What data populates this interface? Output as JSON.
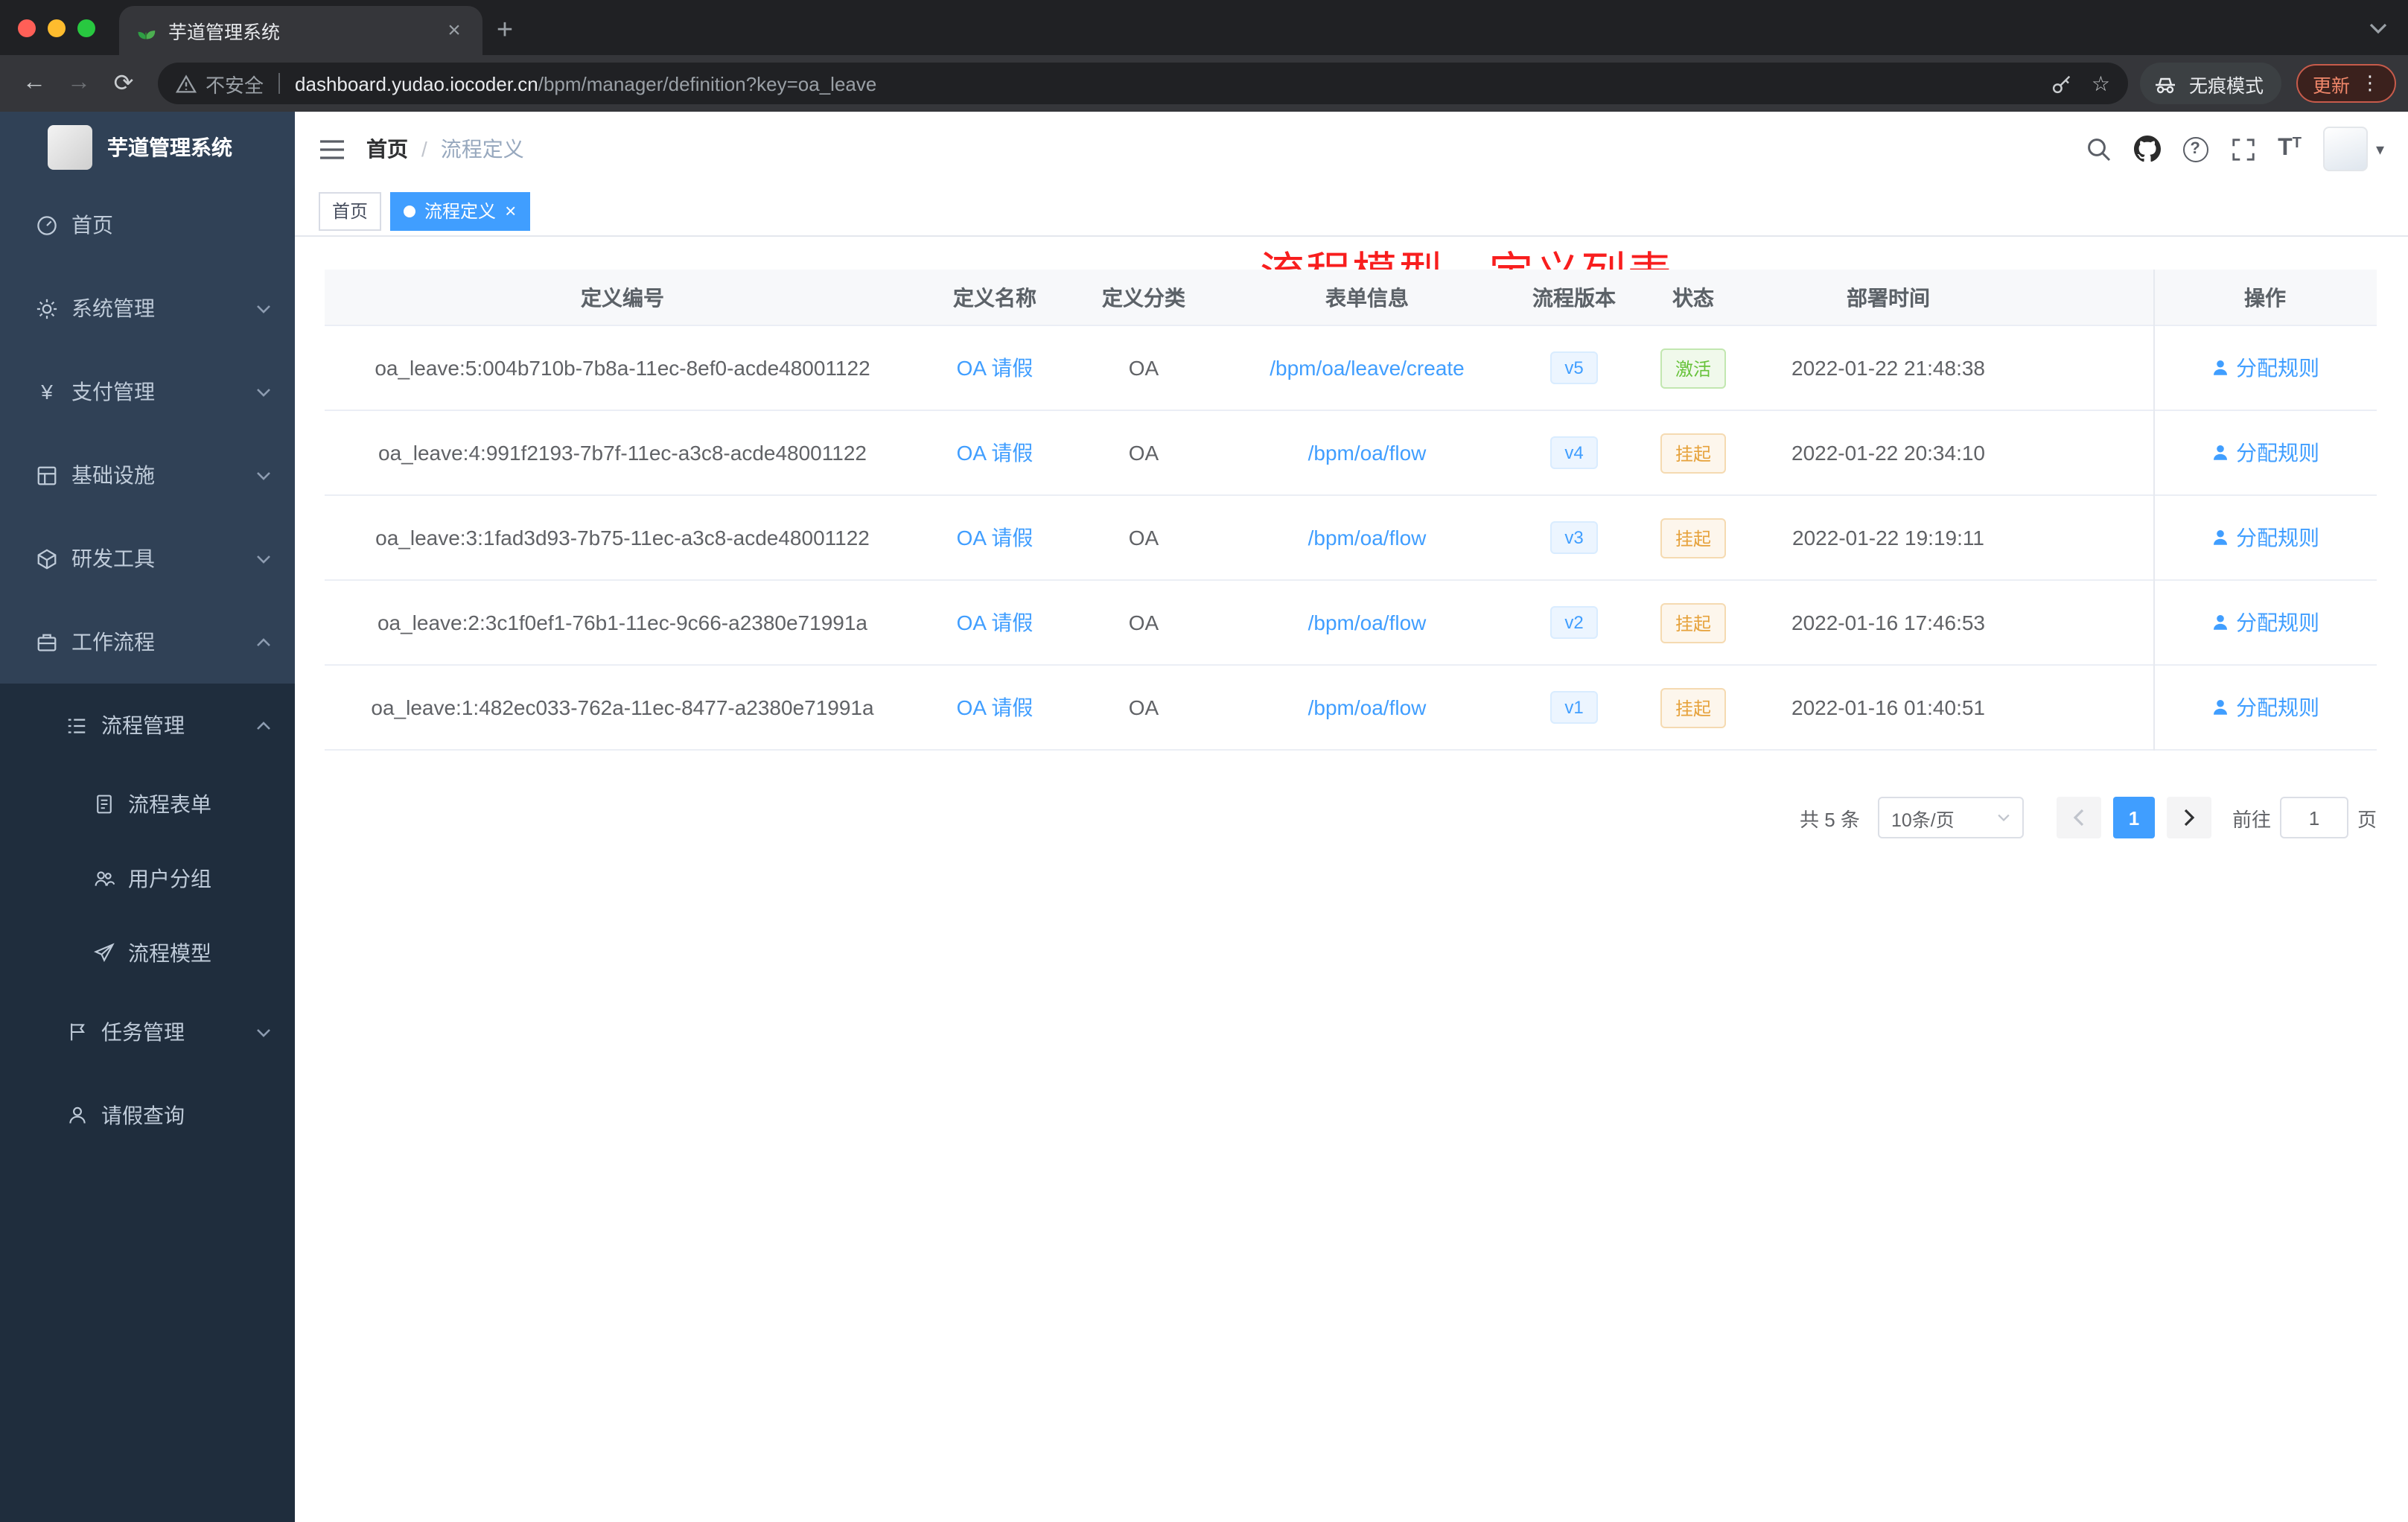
{
  "browser": {
    "tab_title": "芋道管理系统",
    "security_label": "不安全",
    "url_host": "dashboard.yudao.iocoder.cn",
    "url_path": "/bpm/manager/definition?key=oa_leave",
    "incognito_label": "无痕模式",
    "update_label": "更新"
  },
  "icons": {
    "close": "×",
    "new_tab": "+",
    "back": "←",
    "forward": "→",
    "reload": "⟳",
    "star": "☆",
    "overflow_dots": "⋮",
    "question": "?",
    "font_size": "T",
    "caret_down": "▾"
  },
  "sidebar": {
    "app_title": "芋道管理系统",
    "items": [
      {
        "label": "首页"
      },
      {
        "label": "系统管理"
      },
      {
        "label": "支付管理"
      },
      {
        "label": "基础设施"
      },
      {
        "label": "研发工具"
      },
      {
        "label": "工作流程"
      },
      {
        "label": "流程管理"
      },
      {
        "label": "流程表单"
      },
      {
        "label": "用户分组"
      },
      {
        "label": "流程模型"
      },
      {
        "label": "任务管理"
      },
      {
        "label": "请假查询"
      }
    ]
  },
  "header": {
    "breadcrumb": [
      "首页",
      "流程定义"
    ],
    "annotation": "流程模型 - 定义列表"
  },
  "tags": [
    {
      "label": "首页"
    },
    {
      "label": "流程定义"
    }
  ],
  "table": {
    "headers": [
      "定义编号",
      "定义名称",
      "定义分类",
      "表单信息",
      "流程版本",
      "状态",
      "部署时间",
      "操作"
    ],
    "rows": [
      {
        "id": "oa_leave:5:004b710b-7b8a-11ec-8ef0-acde48001122",
        "name": "OA 请假",
        "category": "OA",
        "form": "/bpm/oa/leave/create",
        "version": "v5",
        "status": "激活",
        "time": "2022-01-22 21:48:38",
        "action": "分配规则"
      },
      {
        "id": "oa_leave:4:991f2193-7b7f-11ec-a3c8-acde48001122",
        "name": "OA 请假",
        "category": "OA",
        "form": "/bpm/oa/flow",
        "version": "v4",
        "status": "挂起",
        "time": "2022-01-22 20:34:10",
        "action": "分配规则"
      },
      {
        "id": "oa_leave:3:1fad3d93-7b75-11ec-a3c8-acde48001122",
        "name": "OA 请假",
        "category": "OA",
        "form": "/bpm/oa/flow",
        "version": "v3",
        "status": "挂起",
        "time": "2022-01-22 19:19:11",
        "action": "分配规则"
      },
      {
        "id": "oa_leave:2:3c1f0ef1-76b1-11ec-9c66-a2380e71991a",
        "name": "OA 请假",
        "category": "OA",
        "form": "/bpm/oa/flow",
        "version": "v2",
        "status": "挂起",
        "time": "2022-01-16 17:46:53",
        "action": "分配规则"
      },
      {
        "id": "oa_leave:1:482ec033-762a-11ec-8477-a2380e71991a",
        "name": "OA 请假",
        "category": "OA",
        "form": "/bpm/oa/flow",
        "version": "v1",
        "status": "挂起",
        "time": "2022-01-16 01:40:51",
        "action": "分配规则"
      }
    ]
  },
  "pagination": {
    "total": "共 5 条",
    "page_size": "10条/页",
    "current_page": "1",
    "goto_label": "前往",
    "goto_value": "1",
    "unit_label": "页"
  },
  "colors": {
    "accent": "#409eff",
    "sidebar_bg": "#304156",
    "submenu_bg": "#1f2d3d",
    "annotation_red": "#f81e1e",
    "status_active": "#67c23a",
    "status_suspended": "#e6a23c"
  }
}
